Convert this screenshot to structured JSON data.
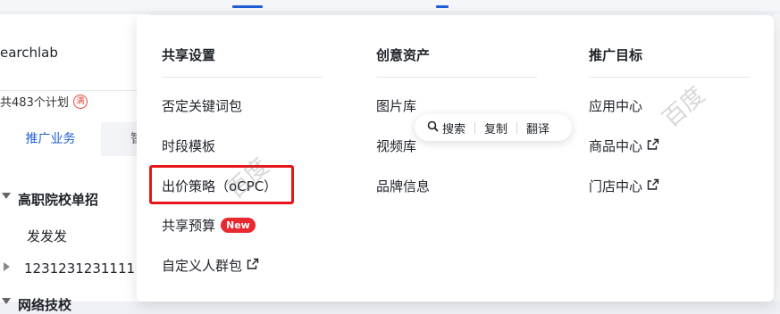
{
  "top_bar": {
    "accent": "#1f5fd6"
  },
  "left_panel": {
    "account_name": "earchlab",
    "plan_count": "共483个计划",
    "full_badge": "满",
    "active_tab": "推广业务",
    "partial_tab": "智",
    "tree": [
      {
        "label": "高职院校单招",
        "expanded": true,
        "bold": true
      },
      {
        "label": "发发发",
        "child": true
      },
      {
        "label": "1231231231111",
        "expanded": false
      },
      {
        "label": "网络技校",
        "expanded": true,
        "bold": true
      }
    ]
  },
  "dropdown": {
    "columns": [
      {
        "heading": "共享设置",
        "items": [
          {
            "label": "否定关键词包"
          },
          {
            "label": "时段模板"
          },
          {
            "label": "出价策略（oCPC）",
            "highlighted": true
          },
          {
            "label": "共享预算",
            "badge": "New"
          },
          {
            "label": "自定义人群包",
            "external": true
          }
        ]
      },
      {
        "heading": "创意资产",
        "items": [
          {
            "label": "图片库"
          },
          {
            "label": "视频库"
          },
          {
            "label": "品牌信息"
          }
        ]
      },
      {
        "heading": "推广目标",
        "items": [
          {
            "label": "应用中心"
          },
          {
            "label": "商品中心",
            "external": true
          },
          {
            "label": "门店中心",
            "external": true
          }
        ]
      }
    ],
    "highlight_color": "#e8151b",
    "badge_color": "#e8292f"
  },
  "selection_toolbar": {
    "search": "搜索",
    "copy": "复制",
    "translate": "翻译"
  },
  "watermarks": [
    "百度",
    "百度"
  ]
}
